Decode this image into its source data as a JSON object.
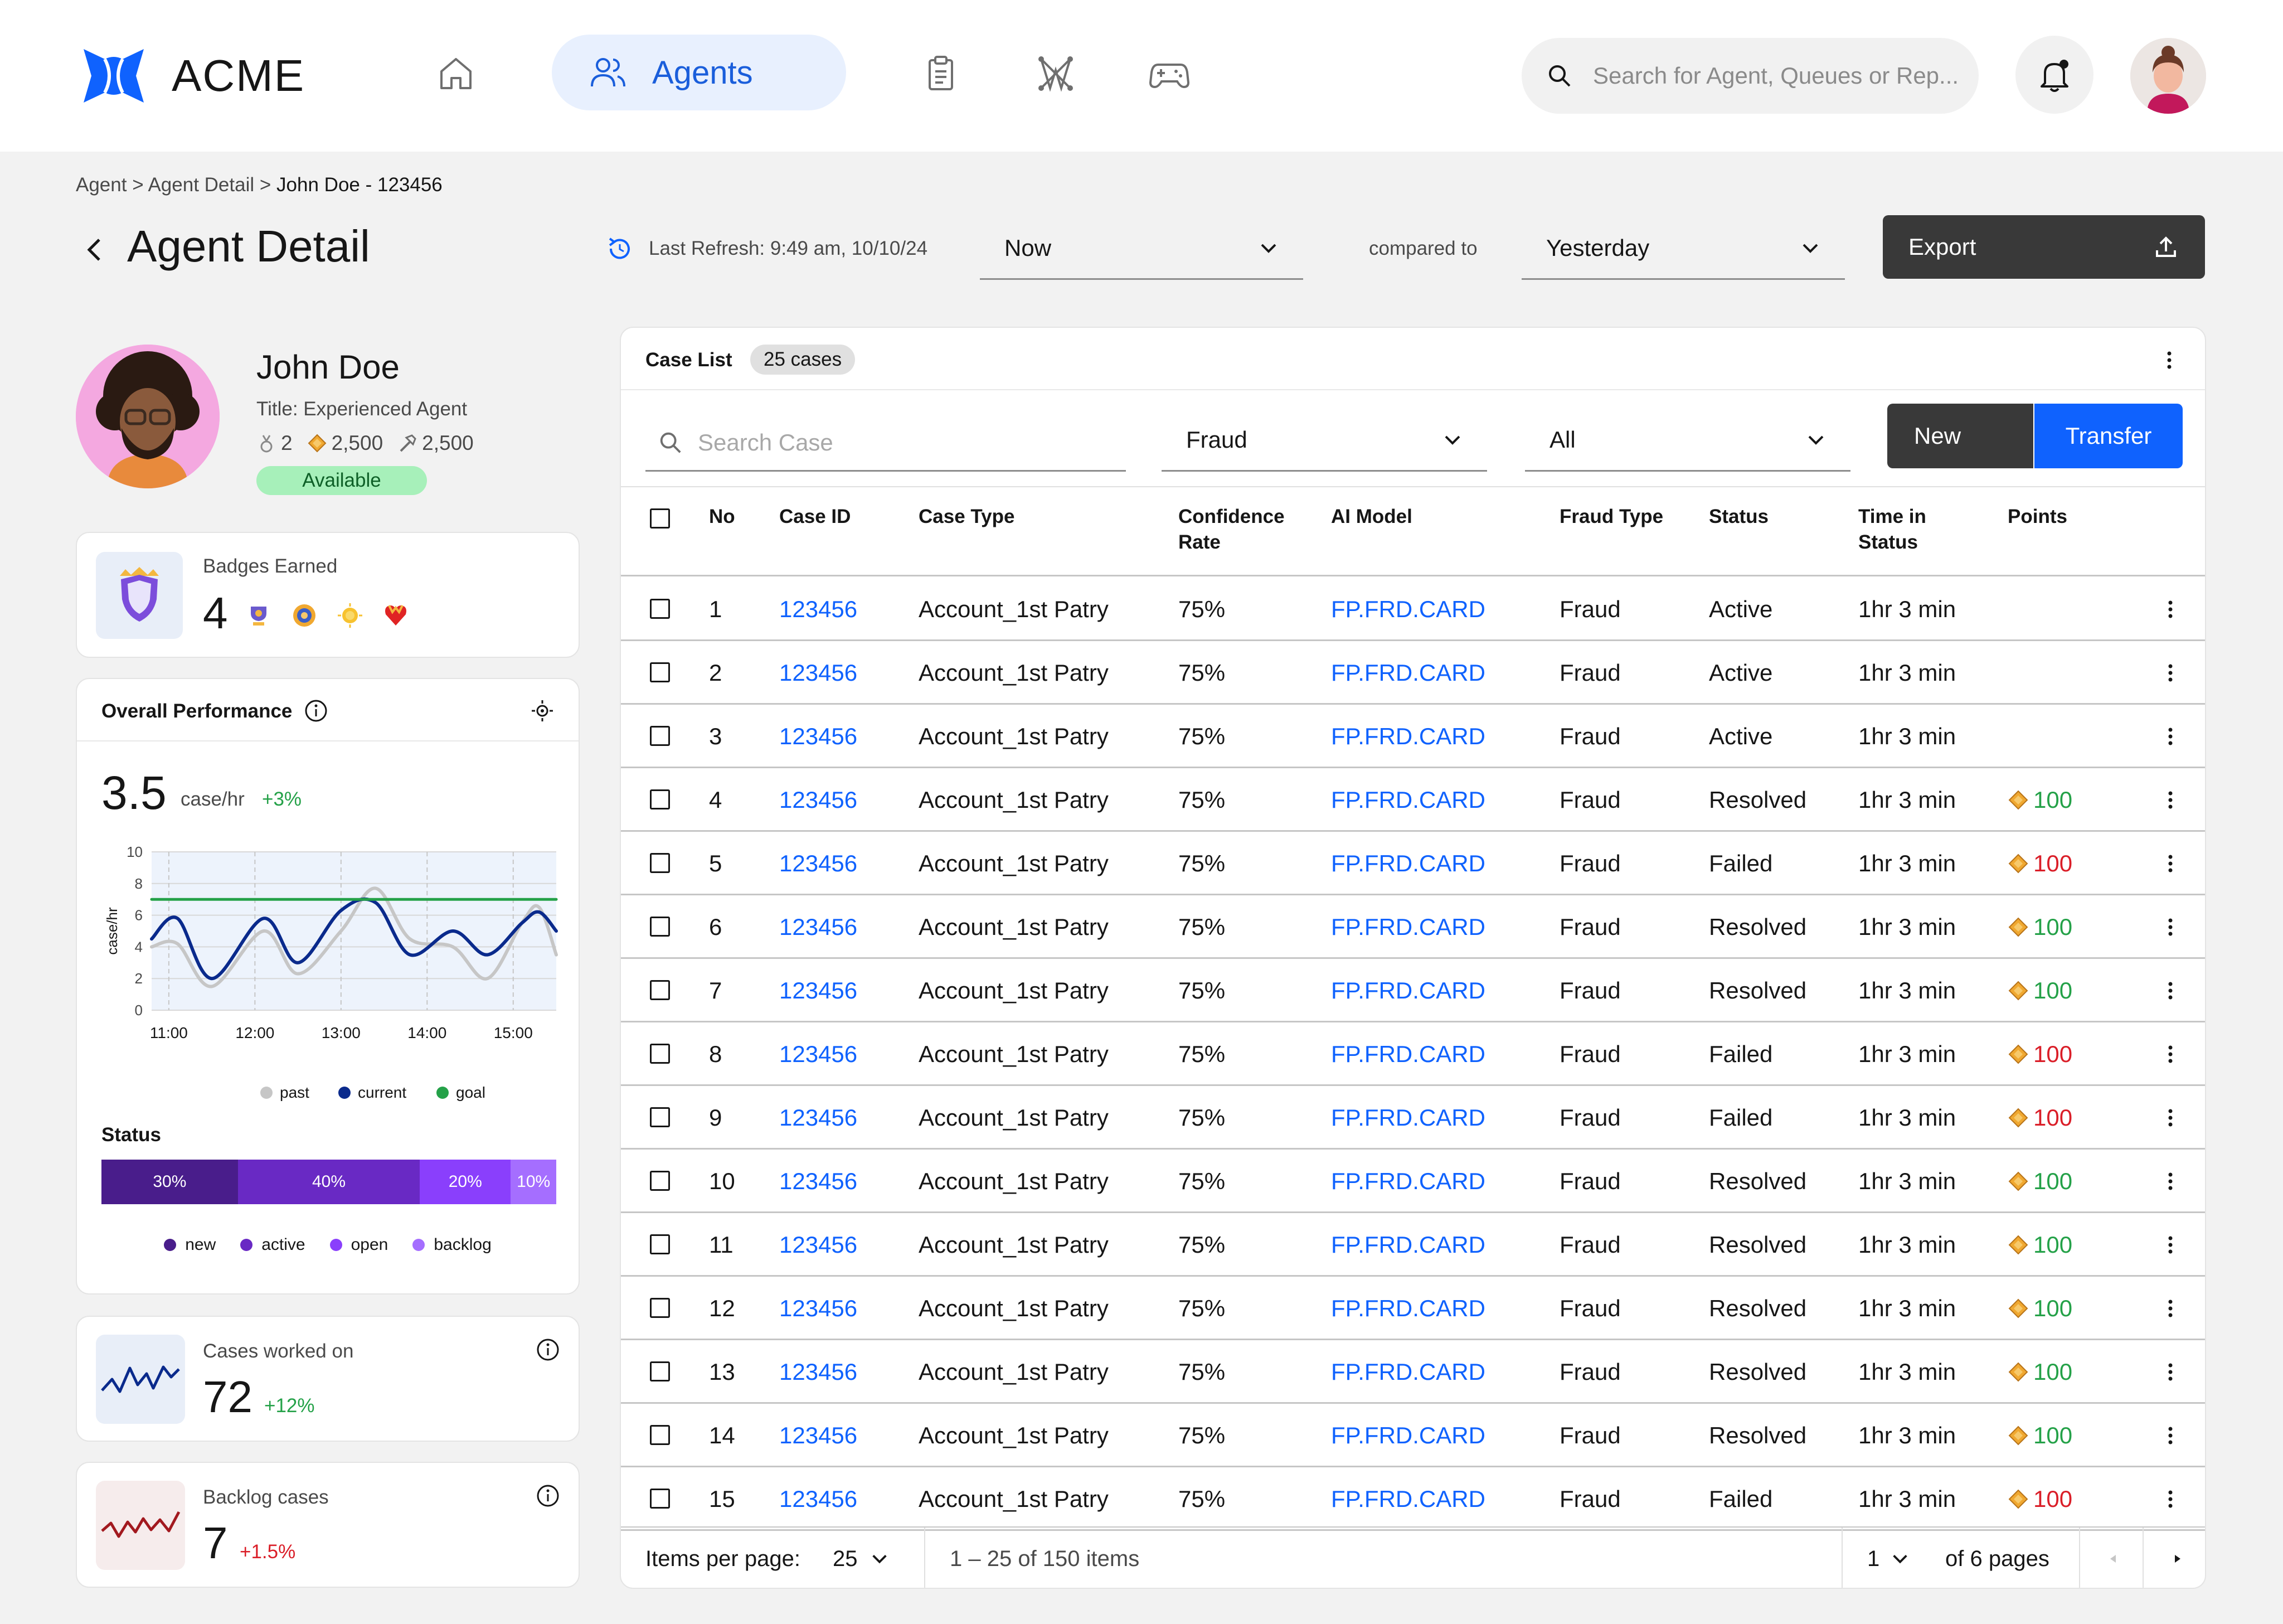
{
  "app": {
    "name": "ACME"
  },
  "nav": {
    "agents_label": "Agents",
    "search_placeholder": "Search for Agent, Queues or Rep..."
  },
  "breadcrumb": {
    "part1": "Agent",
    "sep": ">",
    "part2": "Agent Detail",
    "current": "John Doe - 123456"
  },
  "header": {
    "title": "Agent Detail",
    "last_refresh": "Last Refresh: 9:49 am, 10/10/24",
    "period_value": "Now",
    "compared_label": "compared to",
    "compare_value": "Yesterday",
    "export_label": "Export"
  },
  "profile": {
    "name": "John Doe",
    "title": "Title: Experienced Agent",
    "medals": "2",
    "gems": "2,500",
    "tools": "2,500",
    "status": "Available"
  },
  "badges": {
    "label": "Badges Earned",
    "count": "4"
  },
  "performance": {
    "title": "Overall Performance",
    "value": "3.5",
    "unit": "case/hr",
    "delta": "+3%",
    "status_label": "Status"
  },
  "chart_data": [
    {
      "type": "line",
      "xlabel": "",
      "ylabel": "case/hr",
      "ylim": [
        0,
        10
      ],
      "yticks": [
        "0",
        "2",
        "4",
        "6",
        "8",
        "10"
      ],
      "xticks": [
        "11:00",
        "12:00",
        "13:00",
        "14:00",
        "15:00"
      ],
      "grid": true,
      "legend_position": "bottom",
      "x": [
        10.8,
        11.1,
        11.5,
        12.1,
        12.5,
        13.0,
        13.4,
        13.8,
        14.3,
        14.7,
        15.1,
        15.3,
        15.5
      ],
      "series": [
        {
          "name": "past",
          "color": "#c6c6c6",
          "values": [
            4.0,
            4.2,
            1.5,
            5.0,
            2.3,
            5.0,
            7.7,
            4.5,
            4.0,
            2.0,
            5.5,
            6.5,
            3.5
          ]
        },
        {
          "name": "current",
          "color": "#0a2a8c",
          "values": [
            4.5,
            5.8,
            2.0,
            5.8,
            3.0,
            6.3,
            6.8,
            3.5,
            5.0,
            3.5,
            5.5,
            6.2,
            5.0
          ]
        },
        {
          "name": "goal",
          "color": "#24a148",
          "values": [
            7,
            7,
            7,
            7,
            7,
            7,
            7,
            7,
            7,
            7,
            7,
            7,
            7
          ]
        }
      ]
    },
    {
      "type": "bar",
      "orientation": "stacked-horizontal",
      "categories": [
        "new",
        "active",
        "open",
        "backlog"
      ],
      "values": [
        30,
        40,
        20,
        10
      ],
      "labels": [
        "30%",
        "40%",
        "20%",
        "10%"
      ],
      "colors": [
        "#491d8b",
        "#6929c4",
        "#8a3ffc",
        "#a56eff"
      ]
    }
  ],
  "status_legend": [
    {
      "label": "new",
      "color": "#491d8b"
    },
    {
      "label": "active",
      "color": "#6929c4"
    },
    {
      "label": "open",
      "color": "#8a3ffc"
    },
    {
      "label": "backlog",
      "color": "#a56eff"
    }
  ],
  "cases_worked": {
    "label": "Cases worked on",
    "value": "72",
    "delta": "+12%"
  },
  "backlog": {
    "label": "Backlog cases",
    "value": "7",
    "delta": "+1.5%"
  },
  "case_list": {
    "title": "Case List",
    "count": "25 cases",
    "search_placeholder": "Search Case",
    "filter_type": "Fraud",
    "filter_status": "All",
    "new_label": "New",
    "transfer_label": "Transfer",
    "columns": [
      "No",
      "Case ID",
      "Case Type",
      "Confidence Rate",
      "AI Model",
      "Fraud Type",
      "Status",
      "Time in Status",
      "Points"
    ],
    "rows": [
      {
        "no": "1",
        "id": "123456",
        "type": "Account_1st Patry",
        "conf": "75%",
        "model": "FP.FRD.CARD",
        "fraud": "Fraud",
        "status": "Active",
        "time": "1hr 3 min",
        "points": ""
      },
      {
        "no": "2",
        "id": "123456",
        "type": "Account_1st Patry",
        "conf": "75%",
        "model": "FP.FRD.CARD",
        "fraud": "Fraud",
        "status": "Active",
        "time": "1hr 3 min",
        "points": ""
      },
      {
        "no": "3",
        "id": "123456",
        "type": "Account_1st Patry",
        "conf": "75%",
        "model": "FP.FRD.CARD",
        "fraud": "Fraud",
        "status": "Active",
        "time": "1hr 3 min",
        "points": ""
      },
      {
        "no": "4",
        "id": "123456",
        "type": "Account_1st Patry",
        "conf": "75%",
        "model": "FP.FRD.CARD",
        "fraud": "Fraud",
        "status": "Resolved",
        "time": "1hr 3 min",
        "points": "100"
      },
      {
        "no": "5",
        "id": "123456",
        "type": "Account_1st Patry",
        "conf": "75%",
        "model": "FP.FRD.CARD",
        "fraud": "Fraud",
        "status": "Failed",
        "time": "1hr 3 min",
        "points": "100"
      },
      {
        "no": "6",
        "id": "123456",
        "type": "Account_1st Patry",
        "conf": "75%",
        "model": "FP.FRD.CARD",
        "fraud": "Fraud",
        "status": "Resolved",
        "time": "1hr 3 min",
        "points": "100"
      },
      {
        "no": "7",
        "id": "123456",
        "type": "Account_1st Patry",
        "conf": "75%",
        "model": "FP.FRD.CARD",
        "fraud": "Fraud",
        "status": "Resolved",
        "time": "1hr 3 min",
        "points": "100"
      },
      {
        "no": "8",
        "id": "123456",
        "type": "Account_1st Patry",
        "conf": "75%",
        "model": "FP.FRD.CARD",
        "fraud": "Fraud",
        "status": "Failed",
        "time": "1hr 3 min",
        "points": "100"
      },
      {
        "no": "9",
        "id": "123456",
        "type": "Account_1st Patry",
        "conf": "75%",
        "model": "FP.FRD.CARD",
        "fraud": "Fraud",
        "status": "Failed",
        "time": "1hr 3 min",
        "points": "100"
      },
      {
        "no": "10",
        "id": "123456",
        "type": "Account_1st Patry",
        "conf": "75%",
        "model": "FP.FRD.CARD",
        "fraud": "Fraud",
        "status": "Resolved",
        "time": "1hr 3 min",
        "points": "100"
      },
      {
        "no": "11",
        "id": "123456",
        "type": "Account_1st Patry",
        "conf": "75%",
        "model": "FP.FRD.CARD",
        "fraud": "Fraud",
        "status": "Resolved",
        "time": "1hr 3 min",
        "points": "100"
      },
      {
        "no": "12",
        "id": "123456",
        "type": "Account_1st Patry",
        "conf": "75%",
        "model": "FP.FRD.CARD",
        "fraud": "Fraud",
        "status": "Resolved",
        "time": "1hr 3 min",
        "points": "100"
      },
      {
        "no": "13",
        "id": "123456",
        "type": "Account_1st Patry",
        "conf": "75%",
        "model": "FP.FRD.CARD",
        "fraud": "Fraud",
        "status": "Resolved",
        "time": "1hr 3 min",
        "points": "100"
      },
      {
        "no": "14",
        "id": "123456",
        "type": "Account_1st Patry",
        "conf": "75%",
        "model": "FP.FRD.CARD",
        "fraud": "Fraud",
        "status": "Resolved",
        "time": "1hr 3 min",
        "points": "100"
      },
      {
        "no": "15",
        "id": "123456",
        "type": "Account_1st Patry",
        "conf": "75%",
        "model": "FP.FRD.CARD",
        "fraud": "Fraud",
        "status": "Failed",
        "time": "1hr 3 min",
        "points": "100"
      }
    ]
  },
  "pagination": {
    "items_per_page_label": "Items per page:",
    "items_per_page": "25",
    "range": "1 – 25 of 150 items",
    "page": "1",
    "of_pages": "of 6 pages"
  },
  "colors": {
    "accent": "#0f62fe",
    "positive": "#24a148",
    "negative": "#da1e28",
    "dark_button": "#393939"
  }
}
